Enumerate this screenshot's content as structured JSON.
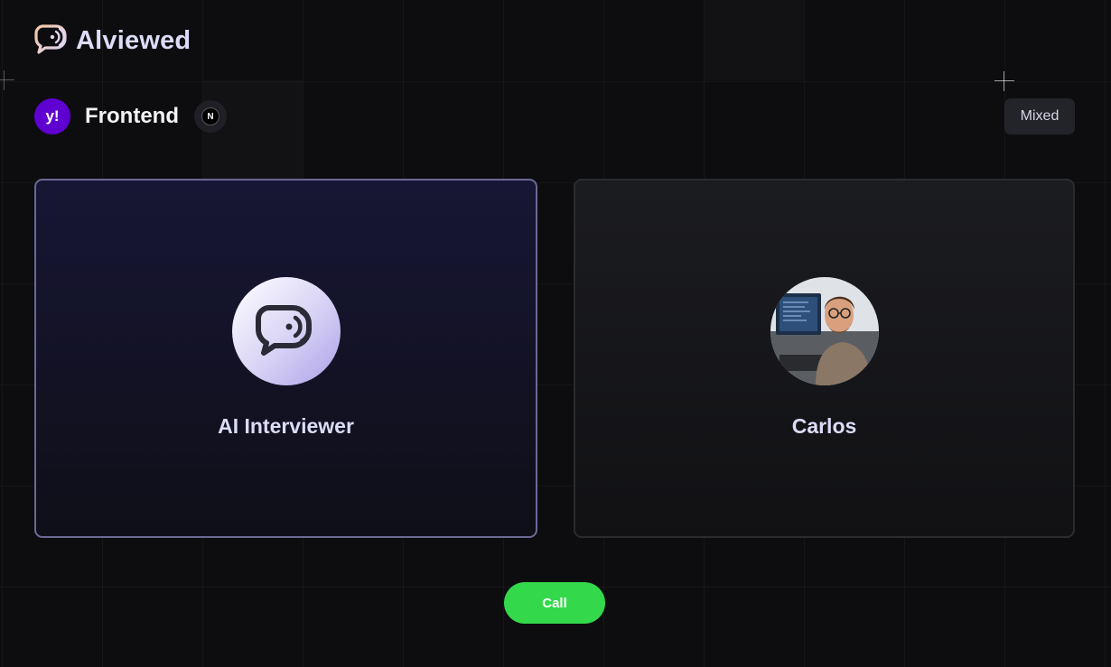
{
  "brand": {
    "name": "Alviewed",
    "logo_icon": "chat-speaker-icon"
  },
  "interview": {
    "company_icon": "yahoo-logo",
    "company_mark": "y!",
    "topic": "Frontend",
    "tech_icon": "nextjs-icon",
    "tech_mark": "N",
    "mode": "Mixed"
  },
  "participants": [
    {
      "name": "AI Interviewer",
      "avatar": "ai-chat-icon"
    },
    {
      "name": "Carlos",
      "avatar": "user-photo"
    }
  ],
  "actions": {
    "call_label": "Call"
  },
  "colors": {
    "background": "#0d0d0f",
    "accent_purple": "#6b6895",
    "call_green": "#33d94a",
    "yahoo_purple": "#5f01d1"
  }
}
